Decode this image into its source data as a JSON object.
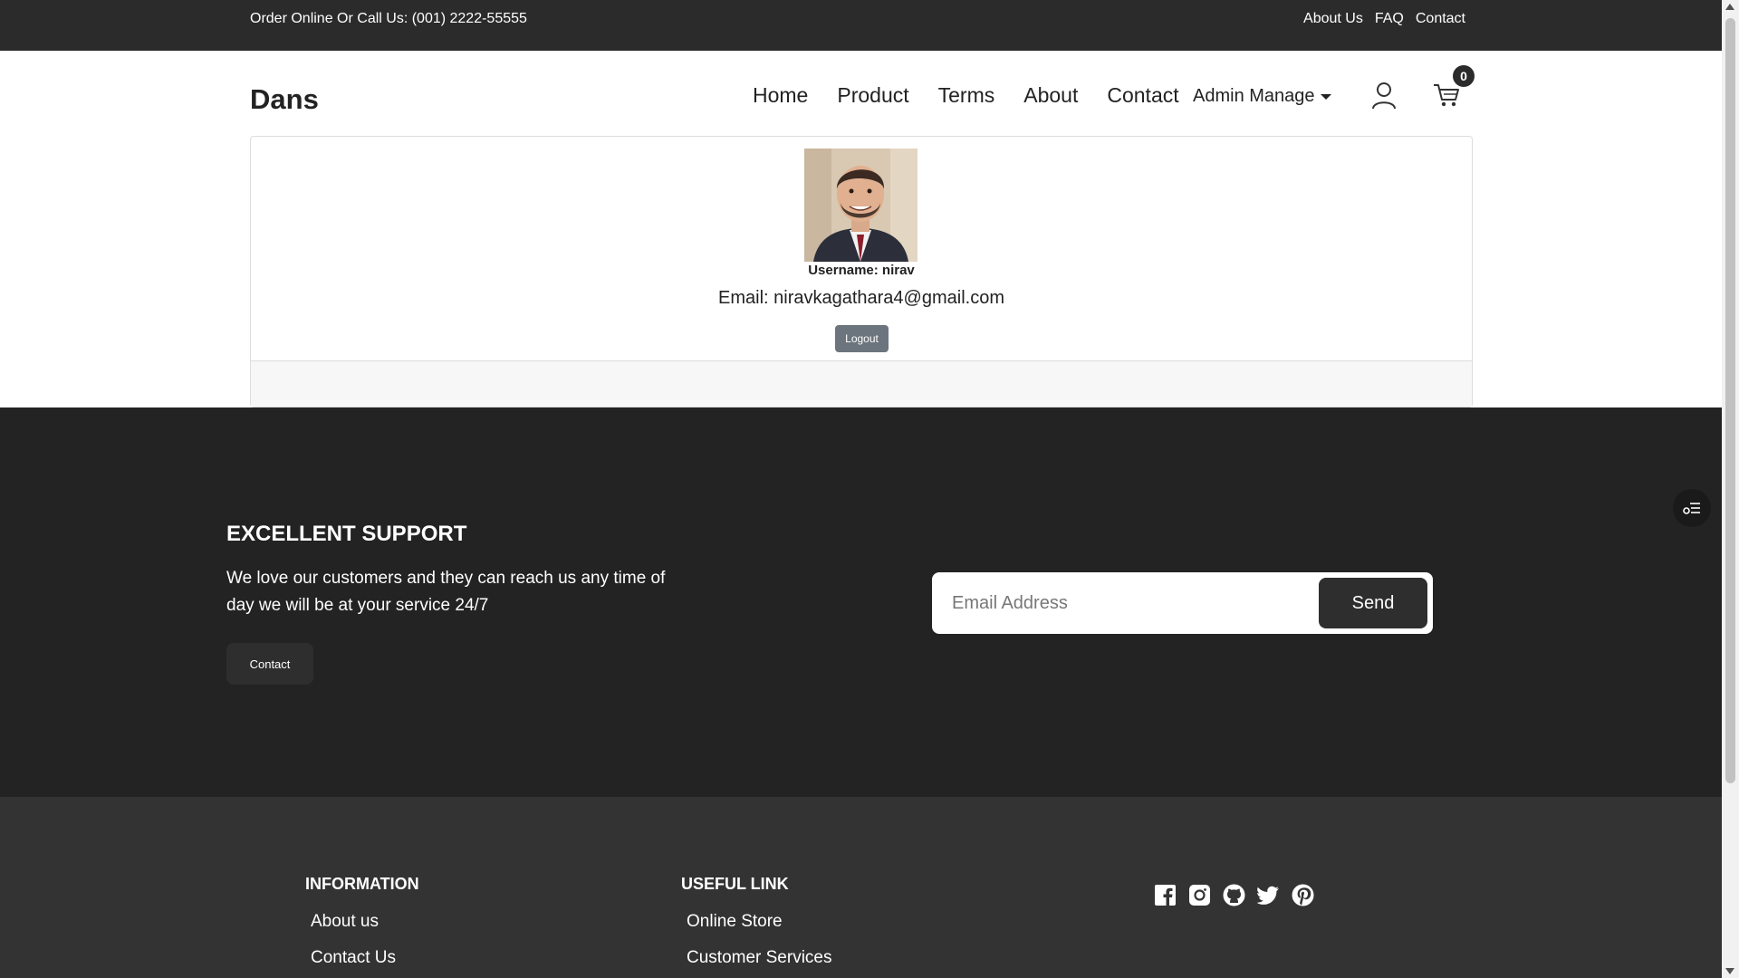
{
  "topbar": {
    "call_text": "Order Online Or Call Us: (001) 2222-55555",
    "links": [
      "About Us",
      "FAQ",
      "Contact"
    ]
  },
  "header": {
    "brand": "Dans",
    "nav": [
      "Home",
      "Product",
      "Terms",
      "About",
      "Contact"
    ],
    "admin_label": "Admin Manage",
    "cart_count": "0",
    "icons": [
      "user-icon",
      "cart-icon"
    ]
  },
  "profile": {
    "username": "Username: nirav",
    "email": "Email: niravkagathara4@gmail.com",
    "logout_label": "Logout"
  },
  "support": {
    "heading": "EXCELLENT SUPPORT",
    "text": "We love our customers and they can reach us any time of day we will be at your service 24/7",
    "contact_label": "Contact",
    "email_placeholder": "Email Address",
    "send_label": "Send"
  },
  "footer": {
    "info_heading": "INFORMATION",
    "info_links": [
      "About us",
      "Contact Us"
    ],
    "useful_heading": "USEFUL LINK",
    "useful_links": [
      "Online Store",
      "Customer Services"
    ],
    "socials": [
      "facebook-icon",
      "instagram-icon",
      "github-icon",
      "twitter-icon",
      "pinterest-icon"
    ]
  },
  "colors": {
    "dark": "#2b2b2b",
    "support_bg": "#232323",
    "footer_bg": "#333333",
    "logout_bg": "#6c757d"
  }
}
